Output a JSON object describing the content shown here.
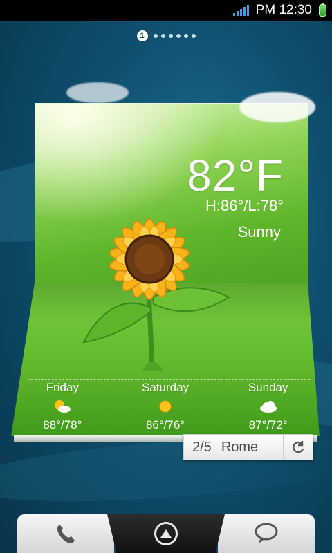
{
  "status_bar": {
    "time": "PM 12:30",
    "signal_icon": "signal-bars-icon",
    "battery_icon": "battery-icon"
  },
  "home_pages": {
    "active_page": "1",
    "dot_count": 6
  },
  "weather": {
    "current_temp": "82°F",
    "high_low": "H:86°/L:78°",
    "condition": "Sunny",
    "forecast": [
      {
        "day": "Friday",
        "icon": "partly-sunny-icon",
        "temps": "88°/78°"
      },
      {
        "day": "Saturday",
        "icon": "sunny-icon",
        "temps": "86°/76°"
      },
      {
        "day": "Sunday",
        "icon": "cloudy-icon",
        "temps": "87°/72°"
      }
    ],
    "city_index": "2/5",
    "city": "Rome",
    "refresh_icon": "refresh-icon"
  },
  "dock": {
    "phone_icon": "phone-icon",
    "launcher_icon": "app-drawer-up-icon",
    "messaging_icon": "speech-bubble-icon"
  },
  "colors": {
    "status_accent": "#39a0e6",
    "widget_green": "#62b82b",
    "background_blue": "#0f4f6e"
  }
}
